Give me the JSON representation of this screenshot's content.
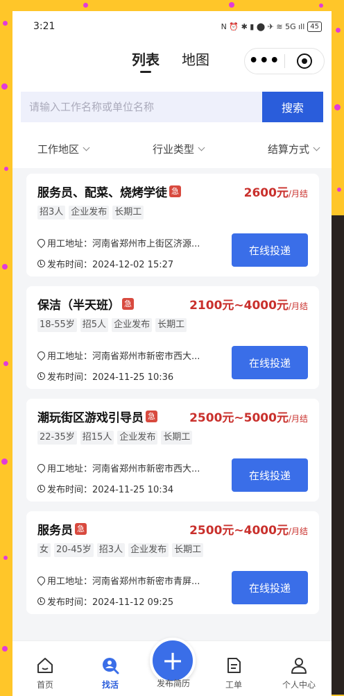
{
  "status_bar": {
    "time": "3:21",
    "icons": "N ⏰ ✱ ▮ ⬤ ✈ ≋ 5G ıll",
    "battery": "45"
  },
  "header": {
    "tabs": [
      {
        "label": "列表"
      },
      {
        "label": "地图"
      }
    ],
    "more_label": "•••"
  },
  "search": {
    "placeholder": "请输入工作名称或单位名称",
    "button_label": "搜索"
  },
  "filters": [
    {
      "label": "工作地区"
    },
    {
      "label": "行业类型"
    },
    {
      "label": "结算方式"
    }
  ],
  "jobs": [
    {
      "title": "服务员、配菜、烧烤学徒",
      "urgent": "急",
      "salary": "2600元",
      "salary_unit": "/月结",
      "tags": [
        "招3人",
        "企业发布",
        "长期工"
      ],
      "address": "用工地址：河南省郑州市上街区济源...",
      "time": "发布时间：2024-12-02 15:27",
      "apply_label": "在线投递"
    },
    {
      "title": "保洁（半天班）",
      "urgent": "急",
      "salary": "2100元~4000元",
      "salary_unit": "/月结",
      "tags": [
        "18-55岁",
        "招5人",
        "企业发布",
        "长期工"
      ],
      "address": "用工地址：河南省郑州市新密市西大...",
      "time": "发布时间：2024-11-25 10:36",
      "apply_label": "在线投递"
    },
    {
      "title": "潮玩街区游戏引导员",
      "urgent": "急",
      "salary": "2500元~5000元",
      "salary_unit": "/月结",
      "tags": [
        "22-35岁",
        "招15人",
        "企业发布",
        "长期工"
      ],
      "address": "用工地址：河南省郑州市新密市西大...",
      "time": "发布时间：2024-11-25 10:34",
      "apply_label": "在线投递"
    },
    {
      "title": "服务员",
      "urgent": "急",
      "salary": "2500元~4000元",
      "salary_unit": "/月结",
      "tags": [
        "女",
        "20-45岁",
        "招3人",
        "企业发布",
        "长期工"
      ],
      "address": "用工地址：河南省郑州市新密市青屏...",
      "time": "发布时间：2024-11-12 09:25",
      "apply_label": "在线投递"
    }
  ],
  "tabbar": {
    "items": [
      {
        "label": "首页",
        "icon": "home-icon"
      },
      {
        "label": "找活",
        "icon": "search-person-icon"
      },
      {
        "label": "工单",
        "icon": "document-icon"
      },
      {
        "label": "个人中心",
        "icon": "user-icon"
      }
    ],
    "fab_label": "发布简历",
    "fab_icon": "+"
  },
  "colors": {
    "primary": "#3a6ee8",
    "salary": "#c9302c",
    "urgent": "#d84a3f",
    "background": "#ffc629"
  }
}
